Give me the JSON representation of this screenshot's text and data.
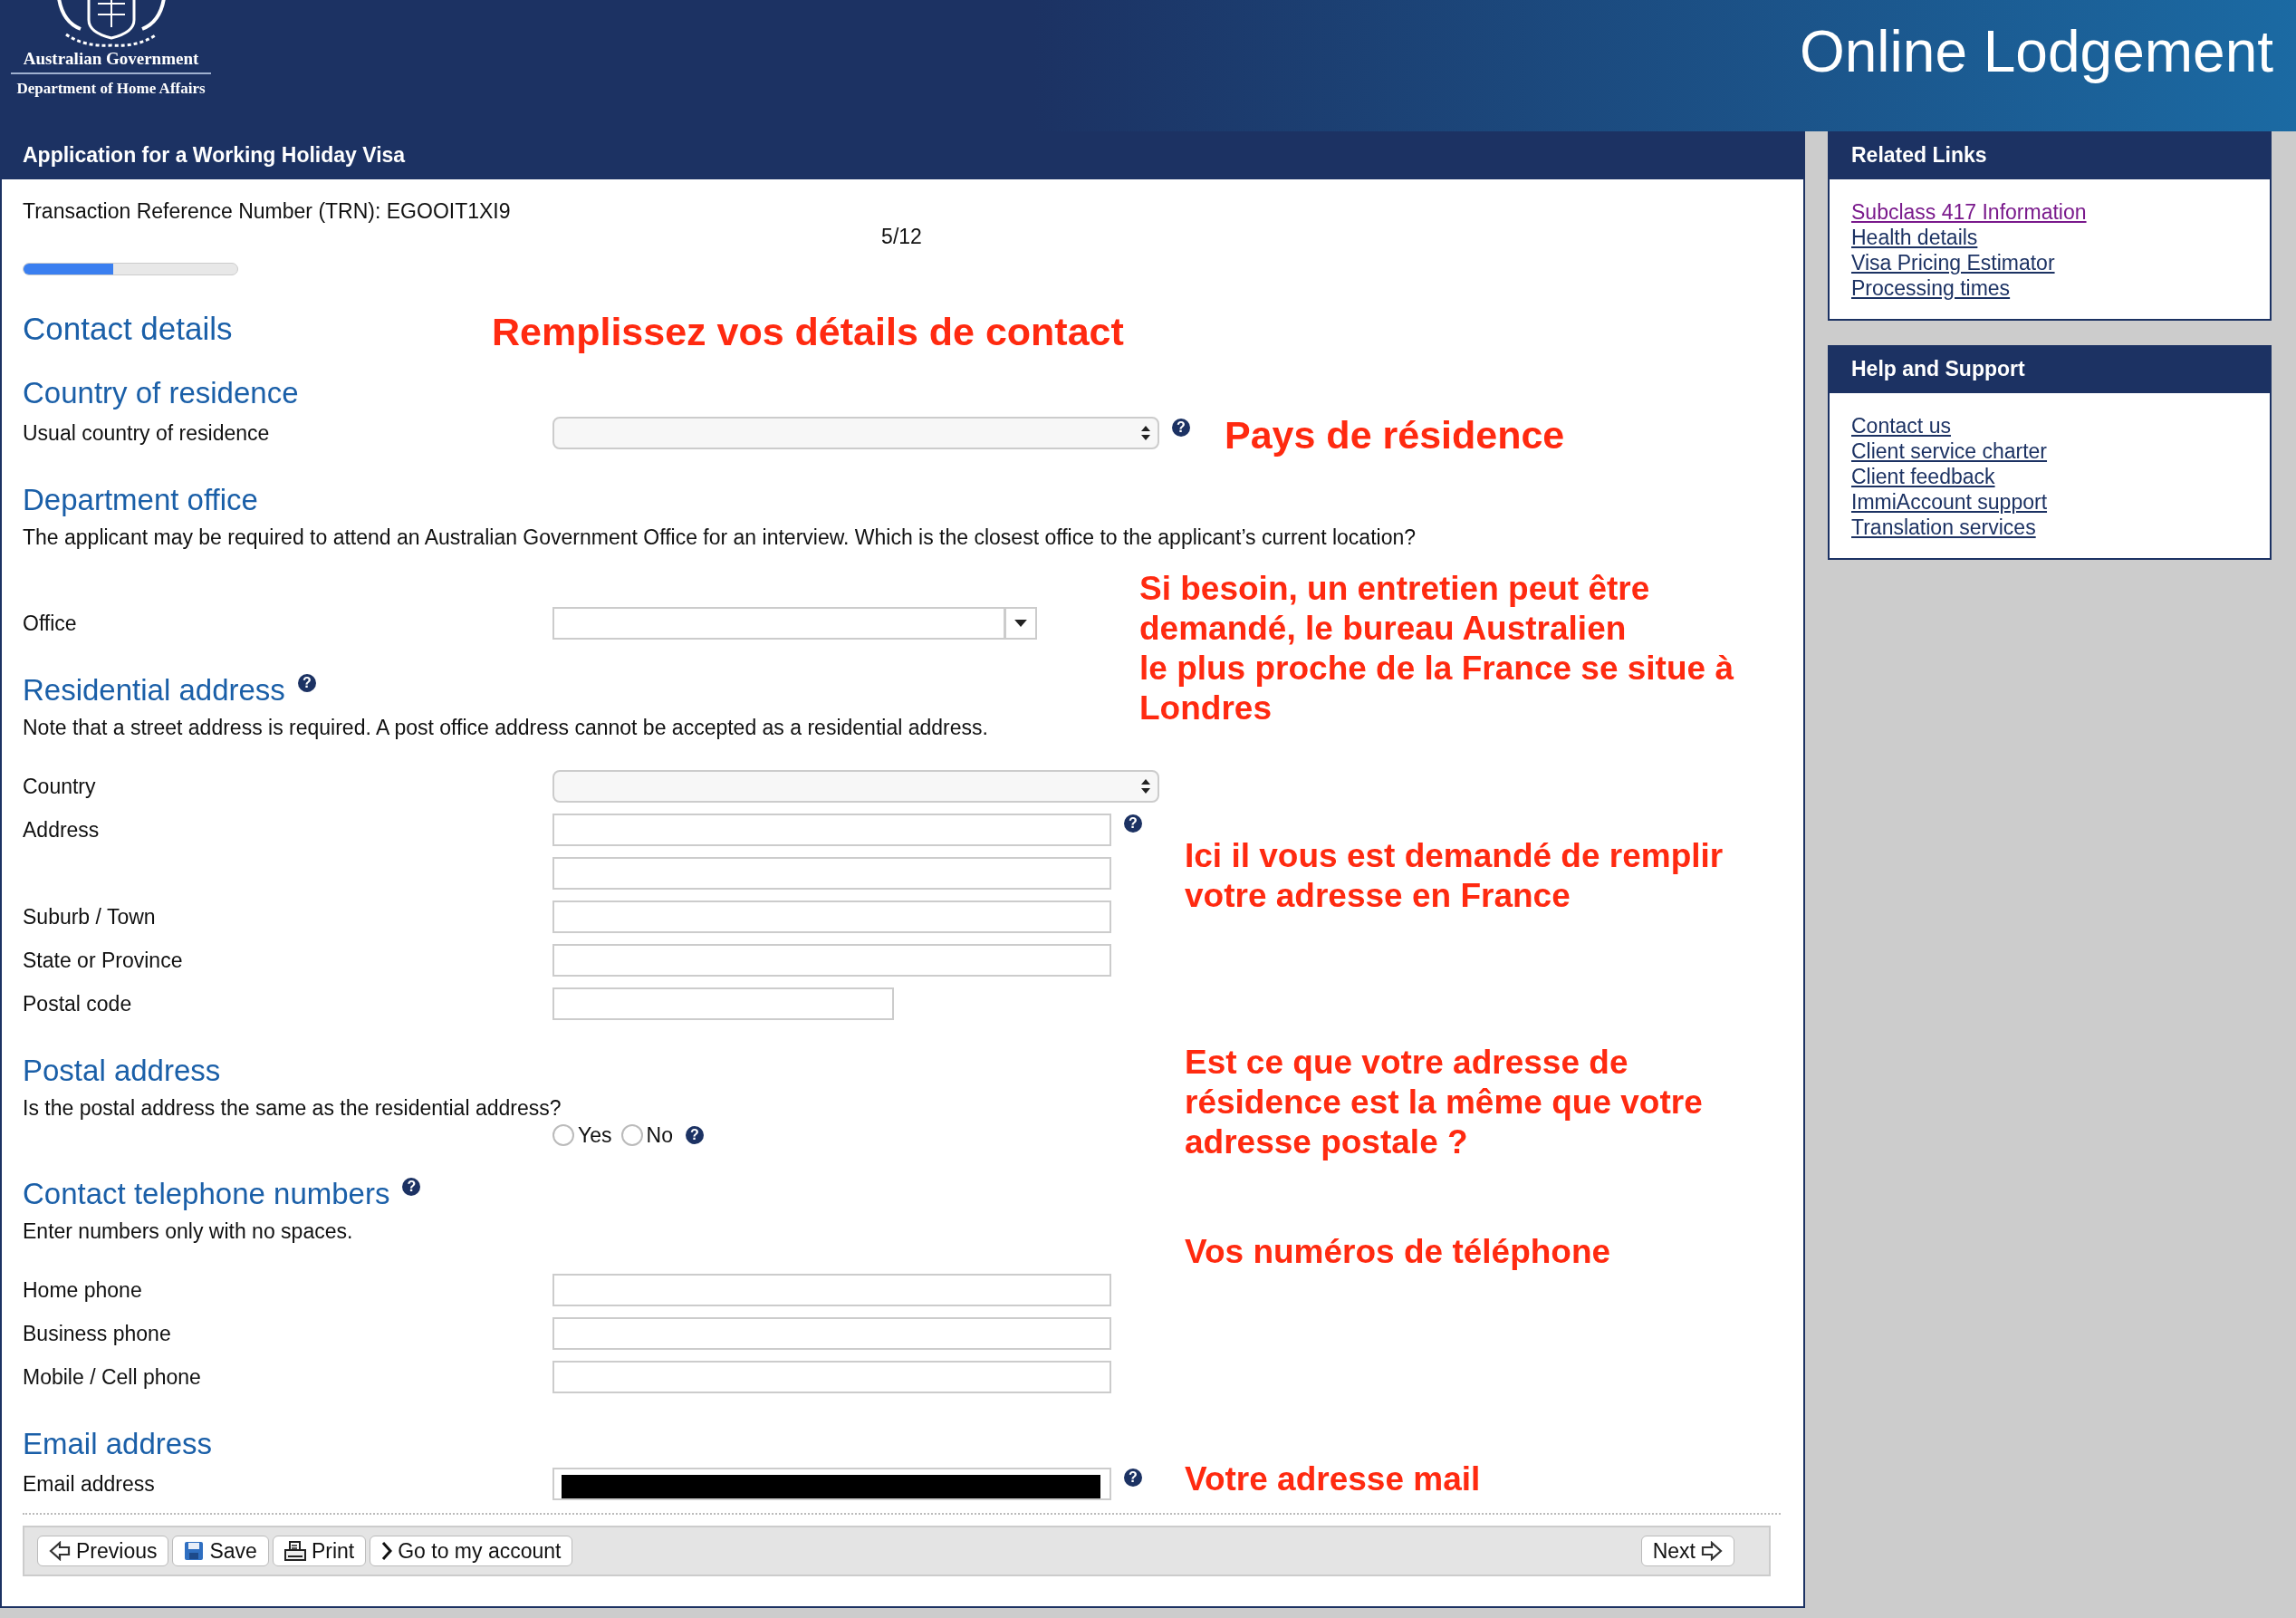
{
  "header": {
    "agency": "Australian Government",
    "department": "Department of Home Affairs",
    "title": "Online Lodgement"
  },
  "application": {
    "title": "Application for a Working Holiday Visa",
    "trn": "Transaction Reference Number (TRN): EGOOIT1XI9",
    "step": "5/12",
    "progress": {
      "level": 0.42
    }
  },
  "page_heading": "Contact details",
  "sections": [
    {
      "heading": "Country of residence",
      "fields": [
        {
          "label": "Usual country of residence",
          "kind": "select",
          "help": "?"
        }
      ]
    },
    {
      "heading": "Department office",
      "note": "The applicant may be required to attend an Australian Government Office for an interview. Which is the closest office to the applicant’s current location?",
      "fields": [
        {
          "label": "Office",
          "kind": "combo"
        }
      ]
    },
    {
      "heading": "Residential address",
      "help": "?",
      "note": "Note that a street address is required. A post office address cannot be accepted as a residential address.",
      "fields": [
        {
          "label": "Country",
          "kind": "select"
        },
        {
          "label": "Address",
          "kind": "text",
          "help": "?"
        },
        {
          "kind": "text"
        },
        {
          "label": "Suburb / Town",
          "kind": "text"
        },
        {
          "label": "State or Province",
          "kind": "text"
        },
        {
          "label": "Postal code",
          "kind": "short"
        }
      ]
    },
    {
      "heading": "Postal address",
      "fields": [
        {
          "question": "Is the postal address the same as the residential address?",
          "kind": "radio",
          "help": "?",
          "options": [
            {
              "label": "Yes",
              "selected": false
            },
            {
              "label": "No",
              "selected": false
            }
          ]
        }
      ]
    },
    {
      "heading": "Contact telephone numbers",
      "help": "?",
      "note": "Enter numbers only with no spaces.",
      "fields": [
        {
          "label": "Home phone",
          "kind": "text"
        },
        {
          "label": "Business phone",
          "kind": "text"
        },
        {
          "label": "Mobile / Cell phone",
          "kind": "text"
        }
      ]
    },
    {
      "heading": "Email address",
      "fields": [
        {
          "label": "Email address",
          "kind": "text",
          "help": "?",
          "redacted": true
        }
      ]
    }
  ],
  "annotations": [
    {
      "text": "Remplissez vos détails de contact"
    },
    {
      "text": "Pays de résidence"
    },
    {
      "text": "Si besoin, un entretien peut être\ndemandé, le bureau Australien\nle plus proche de la France se situe à\nLondres"
    },
    {
      "text": "Ici il vous est demandé de remplir\nvotre adresse en France"
    },
    {
      "text": "Est ce que votre adresse de\nrésidence est la même que votre\nadresse postale ?"
    },
    {
      "text": "Vos numéros de téléphone"
    },
    {
      "text": "Votre adresse mail"
    }
  ],
  "toolbar": {
    "left": [
      "Previous",
      "Save",
      "Print",
      "Go to my account"
    ],
    "right": [
      "Next"
    ]
  },
  "sidebar": [
    {
      "title": "Related Links",
      "links": [
        {
          "label": "Subclass 417 Information",
          "visited": true
        },
        {
          "label": "Health details",
          "visited": false
        },
        {
          "label": "Visa Pricing Estimator",
          "visited": false
        },
        {
          "label": "Processing times",
          "visited": false
        }
      ]
    },
    {
      "title": "Help and Support",
      "links": [
        {
          "label": "Contact us",
          "visited": false
        },
        {
          "label": "Client service charter",
          "visited": false
        },
        {
          "label": "Client feedback",
          "visited": false
        },
        {
          "label": "ImmiAccount support",
          "visited": false
        },
        {
          "label": "Translation services",
          "visited": false
        }
      ]
    }
  ]
}
